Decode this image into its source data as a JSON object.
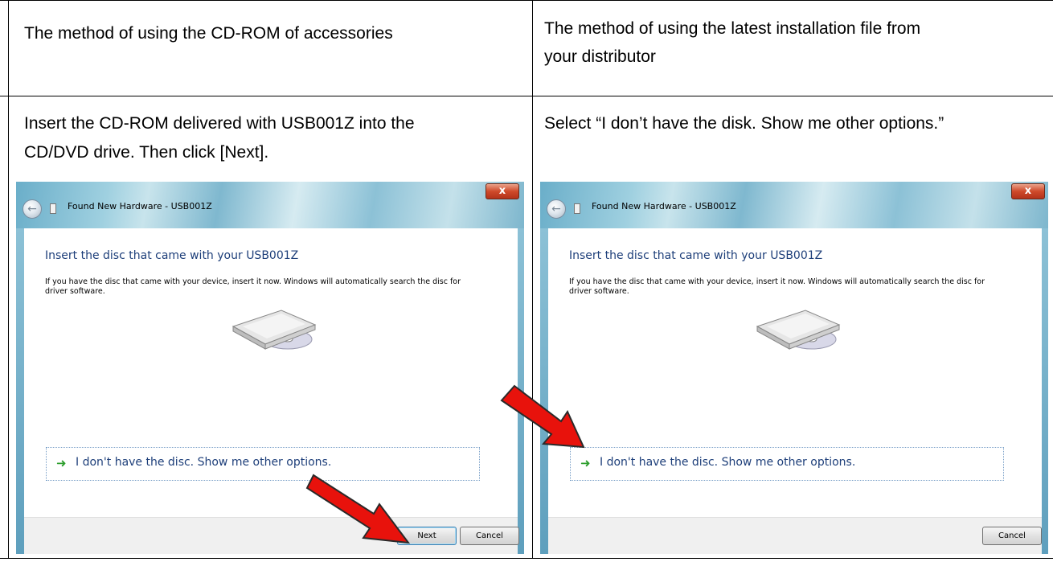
{
  "table": {
    "header_left": "The method of using the CD-ROM of accessories",
    "header_right_line1": "The method of using the latest installation file from",
    "header_right_line2": "your distributor",
    "body_left_line1": "Insert the CD-ROM delivered with USB001Z into the",
    "body_left_line2": "CD/DVD drive. Then click [Next].",
    "body_right_line1": "Select “I don’t have the disk. Show me other options.”"
  },
  "dialog_left": {
    "window_title": "Found New Hardware - USB001Z",
    "heading": "Insert the disc that came with your USB001Z",
    "description": "If you have the disc that came with your device, insert it now.  Windows will automatically search the disc for driver software.",
    "option_label": "I don't have the disc.  Show me other options.",
    "next_label": "Next",
    "cancel_label": "Cancel",
    "close_glyph": "x"
  },
  "dialog_right": {
    "window_title": "Found New Hardware - USB001Z",
    "heading": "Insert the disc that came with your USB001Z",
    "description": "If you have the disc that came with your device, insert it now.  Windows will automatically search the disc for driver software.",
    "option_label": "I don't have the disc.  Show me other options.",
    "cancel_label": "Cancel",
    "close_glyph": "x"
  },
  "colors": {
    "accent_blue": "#1e3f7a",
    "arrow_red": "#e8120c",
    "option_arrow_green": "#2d9e2d"
  }
}
